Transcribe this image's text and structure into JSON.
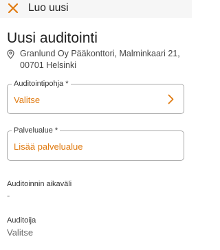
{
  "app_bar": {
    "icon": "close-icon",
    "title": "Luo uusi"
  },
  "page": {
    "title": "Uusi auditointi"
  },
  "location": {
    "icon": "location-pin-icon",
    "line1": "Granlund Oy Pääkonttori, Malminkaari 21,",
    "line2": "00701 Helsinki"
  },
  "fields": {
    "template": {
      "label": "Auditointipohja *",
      "value": "Valitse",
      "icon": "chevron-right-icon"
    },
    "service_area": {
      "label": "Palvelualue *",
      "value": "Lisää palvelualue"
    }
  },
  "period": {
    "label": "Auditoinnin aikaväli",
    "value": "-"
  },
  "auditors": {
    "label": "Auditoija",
    "value": "Valitse"
  },
  "colors": {
    "accent": "#e07a10",
    "app_bar_bg": "#f6f6f6",
    "text": "#222222",
    "muted_text": "#6c6c6c",
    "border": "#a9a9a9"
  }
}
